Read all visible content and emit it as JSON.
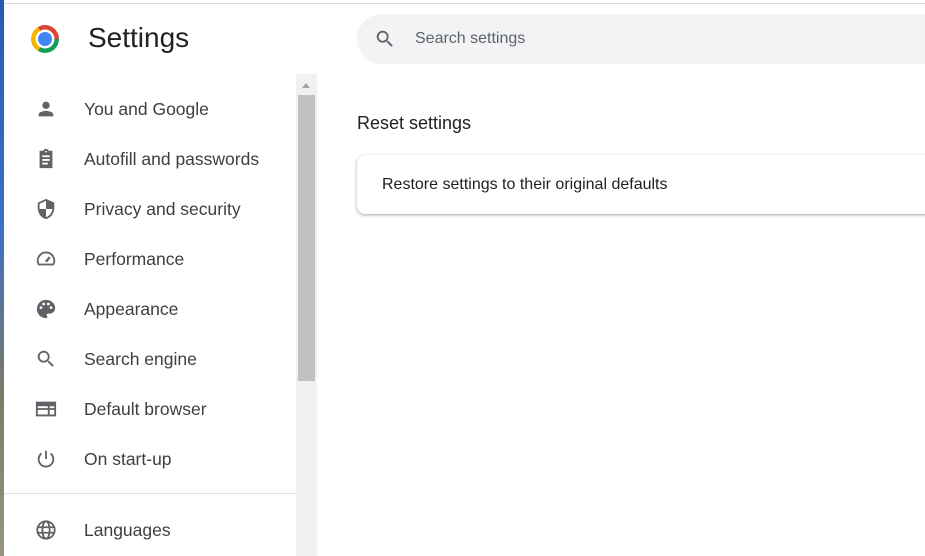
{
  "header": {
    "title": "Settings",
    "search_placeholder": "Search settings"
  },
  "sidebar": {
    "items": [
      {
        "label": "You and Google",
        "icon": "person-icon"
      },
      {
        "label": "Autofill and passwords",
        "icon": "clipboard-icon"
      },
      {
        "label": "Privacy and security",
        "icon": "shield-icon"
      },
      {
        "label": "Performance",
        "icon": "speedometer-icon"
      },
      {
        "label": "Appearance",
        "icon": "palette-icon"
      },
      {
        "label": "Search engine",
        "icon": "search-icon"
      },
      {
        "label": "Default browser",
        "icon": "browser-icon"
      },
      {
        "label": "On start-up",
        "icon": "power-icon"
      },
      {
        "label": "Languages",
        "icon": "globe-icon"
      }
    ]
  },
  "main": {
    "section_title": "Reset settings",
    "restore_label": "Restore settings to their original defaults"
  }
}
